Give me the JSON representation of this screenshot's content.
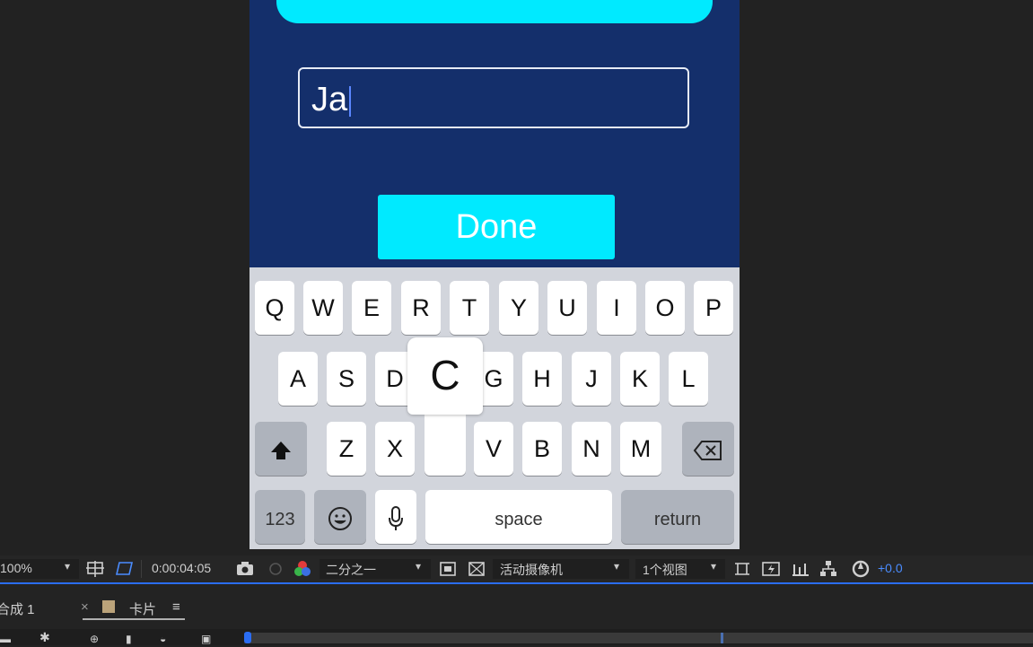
{
  "phone": {
    "name_input_value": "Ja",
    "done_label": "Done",
    "keyboard": {
      "row1": [
        "Q",
        "W",
        "E",
        "R",
        "T",
        "Y",
        "U",
        "I",
        "O",
        "P"
      ],
      "row2": [
        "A",
        "S",
        "D",
        "G",
        "H",
        "J",
        "K",
        "L"
      ],
      "row3": [
        "Z",
        "X",
        "V",
        "B",
        "N",
        "M"
      ],
      "popup_key": "C",
      "numbers_label": "123",
      "space_label": "space",
      "return_label": "return"
    }
  },
  "viewer_toolbar": {
    "zoom": "100%",
    "timecode": "0:00:04:05",
    "resolution": "二分之一",
    "camera": "活动摄像机",
    "views": "1个视图",
    "exposure": "+0.0"
  },
  "timeline_tabs": {
    "comp_tab": "合成 1",
    "close_symbol": "×",
    "active_tab": "卡片",
    "menu_symbol": "≡"
  },
  "colors": {
    "phone_background": "#142f6b",
    "accent_cyan": "#00eaff",
    "app_background": "#222222",
    "ae_blue": "#2a6df4"
  },
  "icons": [
    "shift-icon",
    "backspace-icon",
    "emoji-icon",
    "microphone-icon",
    "snapshot-camera-icon",
    "color-channels-icon",
    "grid-icon",
    "transparency-grid-icon",
    "region-of-interest-icon",
    "fast-preview-icon",
    "flowchart-icon",
    "reset-exposure-icon"
  ]
}
